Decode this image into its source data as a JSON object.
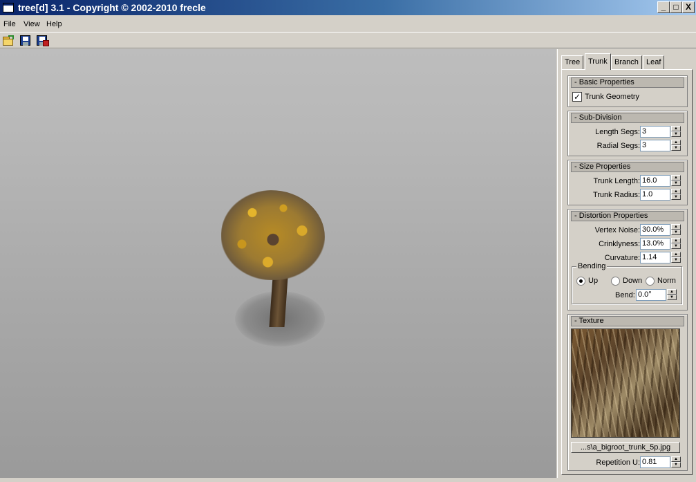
{
  "window": {
    "title": "tree[d] 3.1 - Copyright © 2002-2010 frecle",
    "min": "_",
    "max": "□",
    "close": "X"
  },
  "menu": [
    "File",
    "View",
    "Help"
  ],
  "toolbar": {
    "open_icon": "folder-open-icon",
    "save_icon": "save-icon",
    "save_as_icon": "save-as-icon"
  },
  "tabs": [
    "Tree",
    "Trunk",
    "Branch",
    "Leaf"
  ],
  "active_tab": "Trunk",
  "basic": {
    "header": "- Basic Properties",
    "trunk_geometry": "Trunk Geometry",
    "trunk_geometry_checked": true
  },
  "subdivision": {
    "header": "- Sub-Division",
    "length_segs_label": "Length Segs:",
    "length_segs": "3",
    "radial_segs_label": "Radial Segs:",
    "radial_segs": "3"
  },
  "size": {
    "header": "- Size Properties",
    "trunk_length_label": "Trunk Length:",
    "trunk_length": "16.0",
    "trunk_radius_label": "Trunk Radius:",
    "trunk_radius": "1.0"
  },
  "distortion": {
    "header": "- Distortion Properties",
    "vertex_noise_label": "Vertex Noise:",
    "vertex_noise": "30.0%",
    "crinklyness_label": "Crinklyness:",
    "crinklyness": "13.0%",
    "curvature_label": "Curvature:",
    "curvature": "1.14",
    "bending_label": "Bending",
    "up": "Up",
    "down": "Down",
    "norm": "Norm",
    "selected": "Up",
    "bend_label": "Bend:",
    "bend": "0.0°"
  },
  "texture": {
    "header": "- Texture",
    "file": "...s\\a_bigroot_trunk_5p.jpg",
    "repetition_u_label": "Repetition U:",
    "repetition_u": "0.81"
  }
}
